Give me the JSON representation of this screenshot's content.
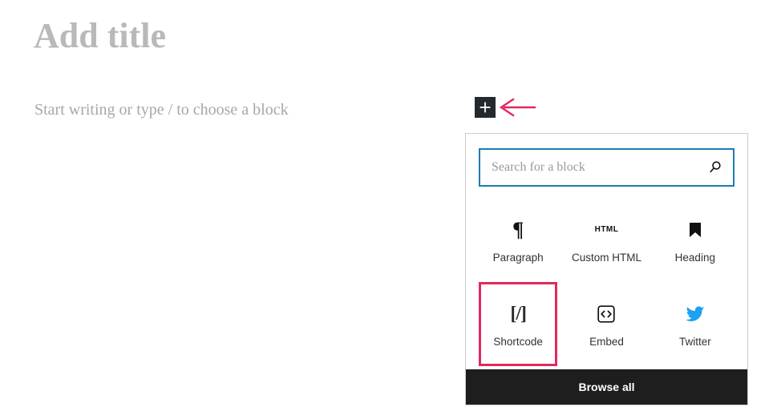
{
  "editor": {
    "title_placeholder": "Add title",
    "block_placeholder": "Start writing or type / to choose a block",
    "inserter_toggle_name": "plus-icon"
  },
  "annotation": {
    "arrow_color": "#e3295c",
    "arrow_name": "pointer-arrow-left"
  },
  "inserter": {
    "search": {
      "placeholder": "Search for a block",
      "value": "",
      "icon": "search-icon",
      "focus_border_color": "#1a7cb5"
    },
    "blocks": [
      {
        "label": "Paragraph",
        "icon": "paragraph-pilcrow-icon",
        "highlighted": false
      },
      {
        "label": "Custom HTML",
        "icon": "html-icon",
        "highlighted": false
      },
      {
        "label": "Heading",
        "icon": "heading-bookmark-icon",
        "highlighted": false
      },
      {
        "label": "Shortcode",
        "icon": "shortcode-icon",
        "highlighted": true
      },
      {
        "label": "Embed",
        "icon": "embed-code-icon",
        "highlighted": false
      },
      {
        "label": "Twitter",
        "icon": "twitter-bird-icon",
        "highlighted": false
      }
    ],
    "highlight_color": "#e3295c",
    "twitter_color": "#1da1f2",
    "browse_all_label": "Browse all",
    "browse_all_background": "#1e1e1e"
  }
}
